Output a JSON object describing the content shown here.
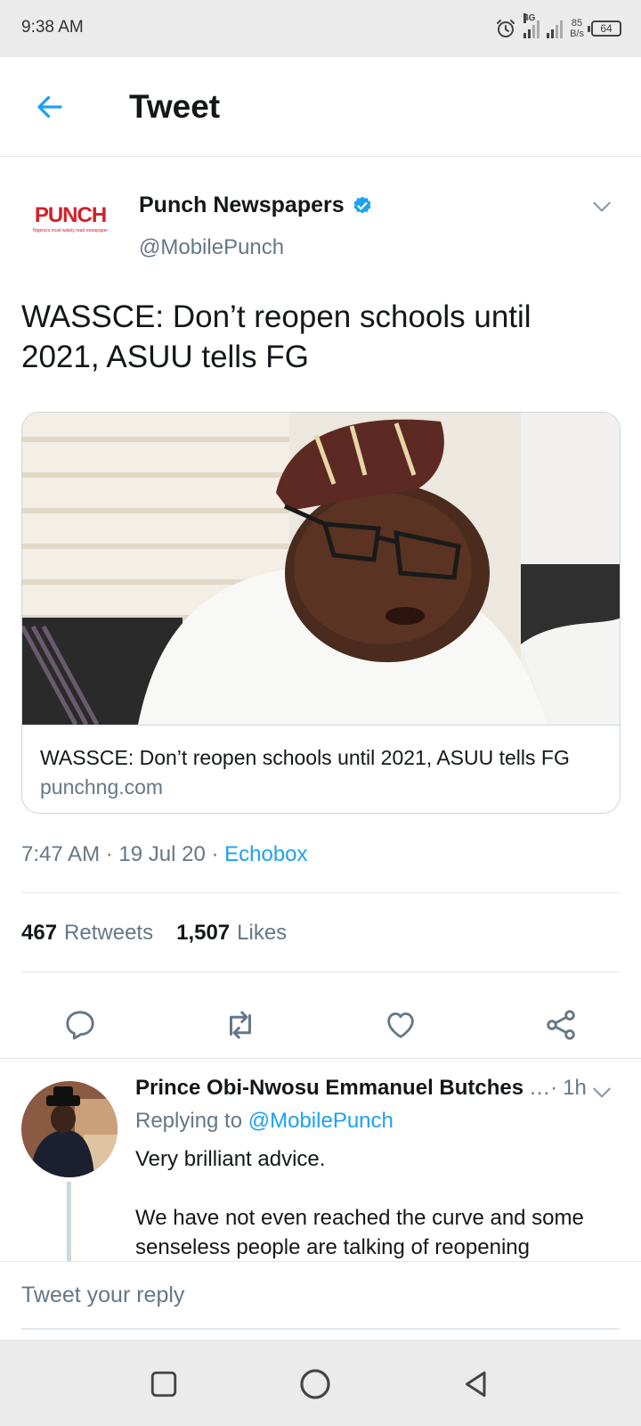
{
  "status_bar": {
    "time": "9:38 AM",
    "network_type": "4G",
    "net_speed_value": "85",
    "net_speed_unit": "B/s",
    "battery": "64"
  },
  "header": {
    "back_icon": "arrow-left-icon",
    "title": "Tweet"
  },
  "tweet": {
    "author_logo_text": "PUNCH",
    "author_logo_tagline": "Nigeria's most widely read newspaper",
    "author_name": "Punch Newspapers",
    "author_handle": "@MobilePunch",
    "text": "WASSCE: Don’t reopen schools until 2021, ASUU tells FG",
    "card": {
      "title": "WASSCE: Don’t reopen schools until 2021, ASUU tells FG",
      "domain": "punchng.com"
    },
    "time": "7:47 AM",
    "date": "19 Jul 20",
    "source": "Echobox",
    "retweets_count": "467",
    "retweets_label": "Retweets",
    "likes_count": "1,507",
    "likes_label": "Likes"
  },
  "reply": {
    "author_name": "Prince Obi-Nwosu Emmanuel  Butches",
    "time": "1h",
    "replying_label": "Replying to",
    "replying_handle": "@MobilePunch",
    "body_line1": "Very brilliant advice.",
    "body_line2": "We have not even reached the curve and some senseless people are talking of reopening"
  },
  "composer": {
    "placeholder": "Tweet your reply"
  },
  "colors": {
    "accent": "#1da1f2",
    "secondary_text": "#657786",
    "divider": "#e1e8ed",
    "brand_red": "#d32027"
  }
}
